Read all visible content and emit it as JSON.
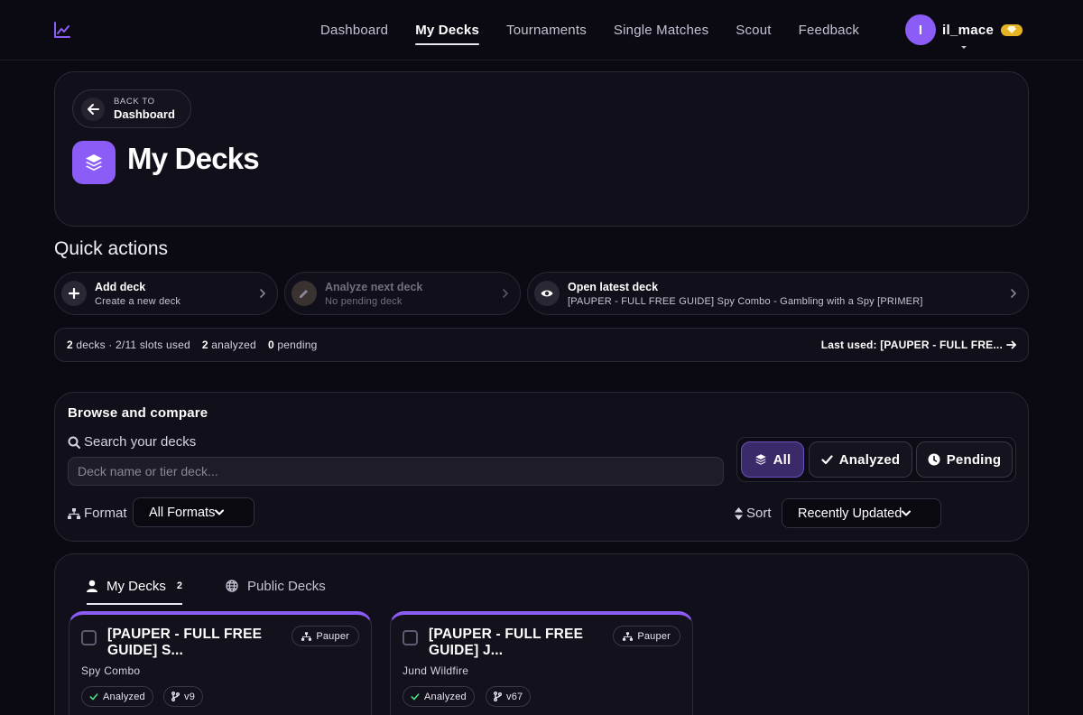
{
  "nav": {
    "links": [
      "Dashboard",
      "My Decks",
      "Tournaments",
      "Single Matches",
      "Scout",
      "Feedback"
    ],
    "active": "My Decks",
    "user": {
      "initial": "I",
      "name": "il_mace"
    }
  },
  "header": {
    "back_small": "BACK TO",
    "back_target": "Dashboard",
    "title": "My Decks"
  },
  "quick_actions": {
    "heading": "Quick actions",
    "items": [
      {
        "title": "Add deck",
        "subtitle": "Create a new deck",
        "icon": "plus-icon",
        "enabled": true
      },
      {
        "title": "Analyze next deck",
        "subtitle": "No pending deck",
        "icon": "pencil-icon",
        "enabled": false
      },
      {
        "title": "Open latest deck",
        "subtitle": "[PAUPER - FULL FREE GUIDE] Spy Combo - Gambling with a Spy [PRIMER]",
        "icon": "eye-icon",
        "enabled": true
      }
    ]
  },
  "stats": {
    "decks_count": "2",
    "decks_label": "decks · 2/11 slots used",
    "analyzed_count": "2",
    "analyzed_label": "analyzed",
    "pending_count": "0",
    "pending_label": "pending",
    "last_used": "Last used: [PAUPER - FULL FRE..."
  },
  "browse": {
    "title": "Browse and compare",
    "search_label": "Search your decks",
    "search_placeholder": "Deck name or tier deck...",
    "search_value": "",
    "filters": [
      "All",
      "Analyzed",
      "Pending"
    ],
    "active_filter": "All",
    "format_label": "Format",
    "format_value": "All Formats",
    "sort_label": "Sort",
    "sort_value": "Recently Updated"
  },
  "decks": {
    "tabs": [
      {
        "label": "My Decks",
        "count": "2",
        "active": true
      },
      {
        "label": "Public Decks",
        "count": "",
        "active": false
      }
    ],
    "cards": [
      {
        "name": "[PAUPER - FULL FREE GUIDE] S...",
        "format": "Pauper",
        "archetype": "Spy Combo",
        "status": "Analyzed",
        "version": "v9"
      },
      {
        "name": "[PAUPER - FULL FREE GUIDE] J...",
        "format": "Pauper",
        "archetype": "Jund Wildfire",
        "status": "Analyzed",
        "version": "v67"
      }
    ]
  },
  "colors": {
    "accent": "#8b5cf6",
    "background": "#0b0a12",
    "card": "#110f19",
    "vip_badge": "#e6b422",
    "analyzed_check": "#4ade80"
  }
}
